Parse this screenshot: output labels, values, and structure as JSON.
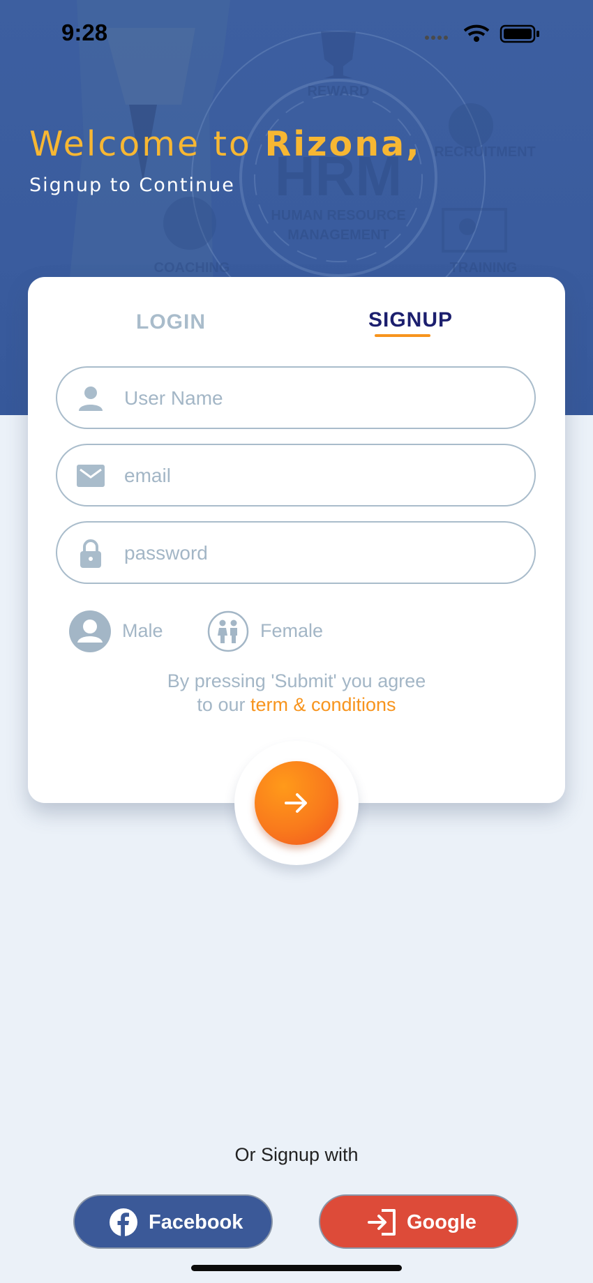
{
  "status_bar": {
    "time": "9:28"
  },
  "hero": {
    "welcome_prefix": "Welcome to ",
    "brand": "Rizona,",
    "subtitle": "Signup to Continue",
    "background_labels": [
      "REWARD",
      "RECRUITMENT",
      "HRM",
      "HUMAN RESOURCE",
      "MANAGEMENT",
      "COACHING",
      "TRAINING"
    ]
  },
  "tabs": [
    {
      "label": "LOGIN",
      "active": false
    },
    {
      "label": "SIGNUP",
      "active": true
    }
  ],
  "form": {
    "username": {
      "placeholder": "User Name",
      "value": "",
      "icon": "person-icon"
    },
    "email": {
      "placeholder": "email",
      "value": "",
      "icon": "mail-icon"
    },
    "password": {
      "placeholder": "password",
      "value": "",
      "icon": "lock-icon"
    }
  },
  "gender": {
    "options": [
      {
        "label": "Male",
        "icon": "male-avatar-icon"
      },
      {
        "label": "Female",
        "icon": "female-couple-icon"
      }
    ]
  },
  "terms": {
    "line1": "By pressing 'Submit' you agree",
    "line2_prefix": "to our ",
    "link": "term & conditions"
  },
  "submit": {
    "icon": "arrow-right-icon"
  },
  "social": {
    "heading": "Or Signup with",
    "facebook": {
      "label": "Facebook",
      "icon": "facebook-icon"
    },
    "google": {
      "label": "Google",
      "icon": "sign-in-icon"
    }
  },
  "colors": {
    "hero": "#3b5d9f",
    "accent_yellow": "#f7b733",
    "accent_orange": "#f7941d",
    "tab_active": "#1c1f6e",
    "facebook": "#3b5998",
    "google": "#dd4b39"
  }
}
